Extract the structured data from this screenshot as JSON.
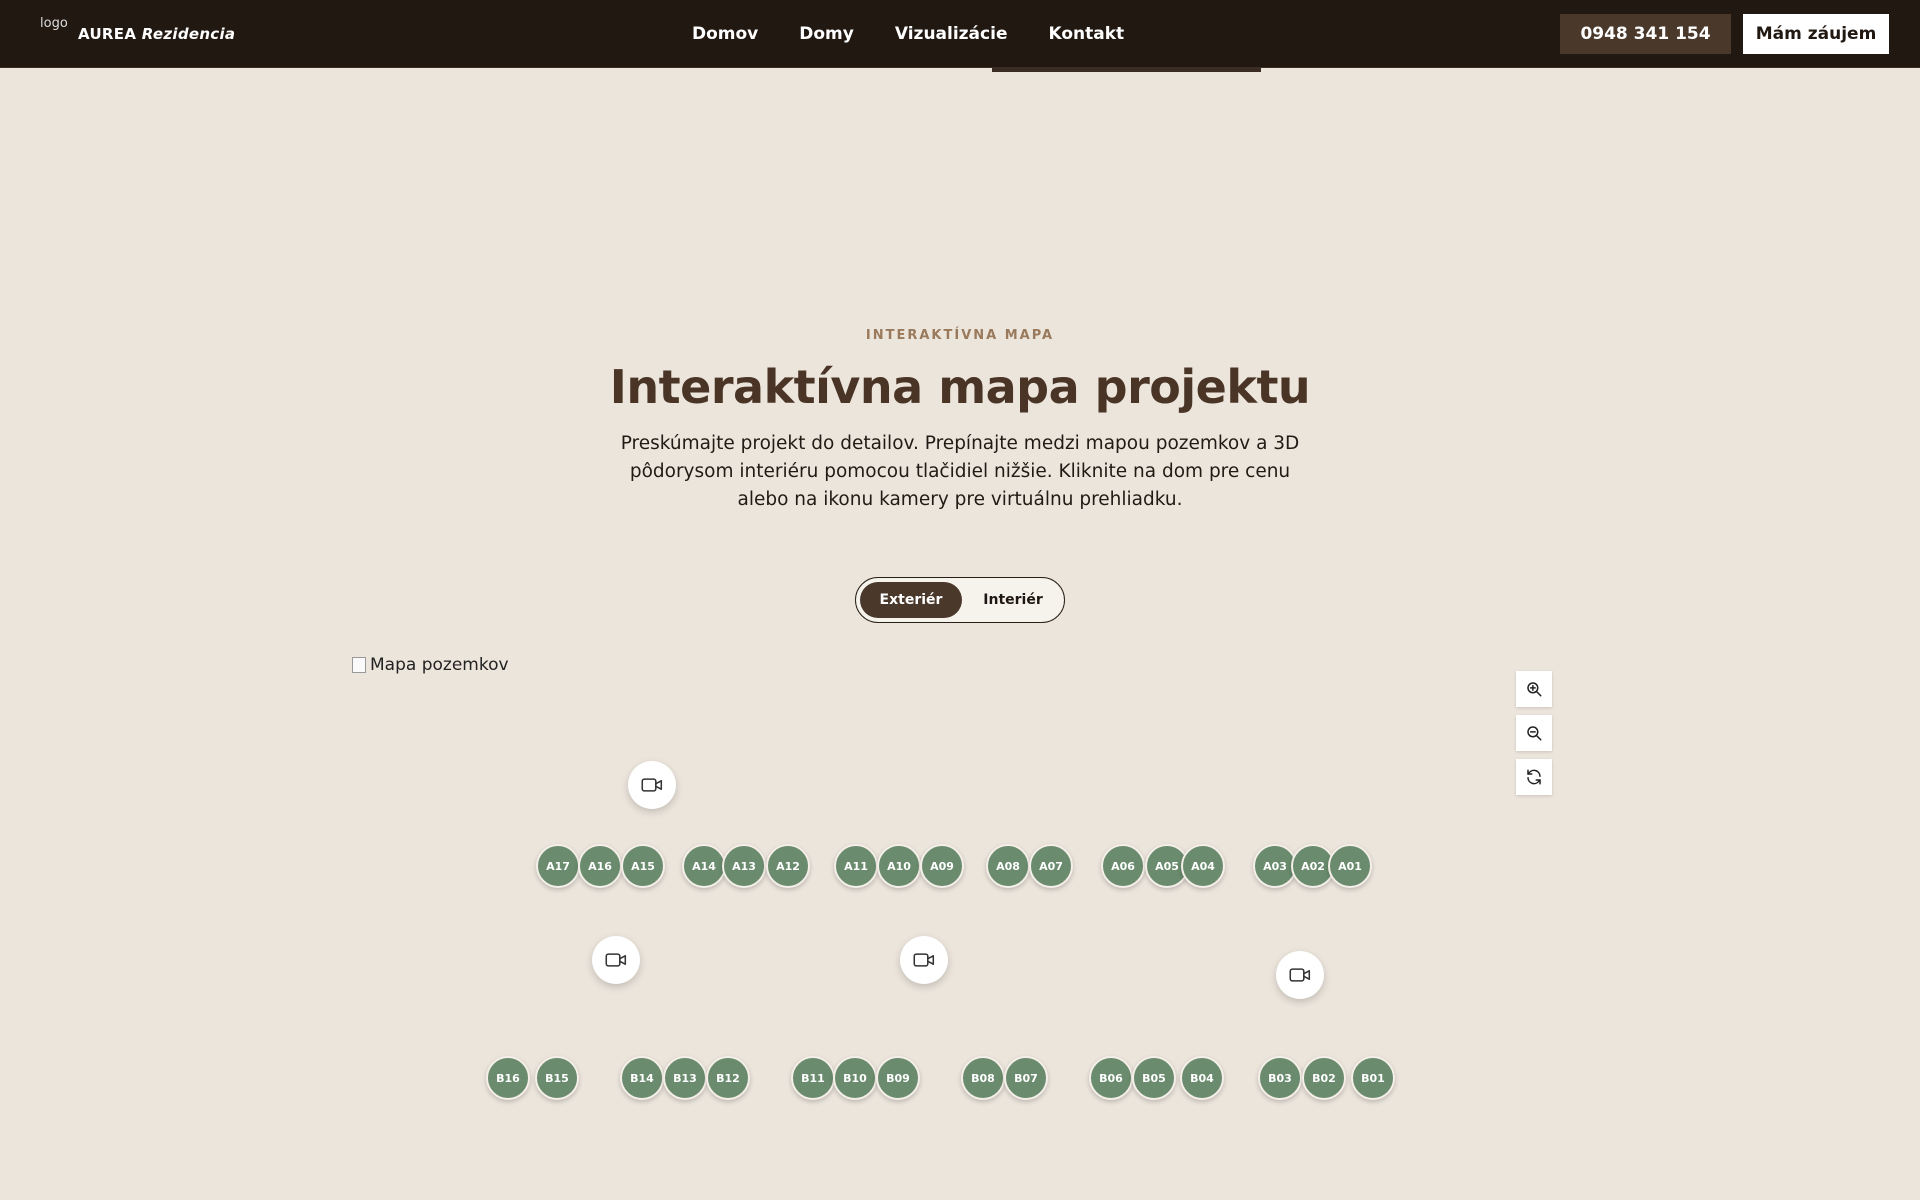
{
  "header": {
    "logo_alt": "logo",
    "brand_name": "AUREA",
    "brand_tagline": "Rezidencia",
    "nav": [
      "Domov",
      "Domy",
      "Vizualizácie",
      "Kontakt"
    ],
    "phone": "0948 341 154",
    "cta": "Mám záujem"
  },
  "hero": {
    "eyebrow": "INTERAKTÍVNA MAPA",
    "title": "Interaktívna mapa projektu",
    "lead": "Preskúmajte projekt do detailov. Prepínajte medzi mapou pozemkov a 3D pôdorysom interiéru pomocou tlačidiel nižšie. Kliknite na dom pre cenu alebo na ikonu kamery pre virtuálnu prehliadku."
  },
  "toggle": {
    "exterior": "Exteriér",
    "interior": "Interiér",
    "active": "Exteriér"
  },
  "map": {
    "image_alt": "Mapa pozemkov",
    "controls": [
      "zoom-in-icon",
      "zoom-out-icon",
      "reset-icon"
    ],
    "houses_row_a": [
      "A17",
      "A16",
      "A15",
      "A14",
      "A13",
      "A12",
      "A11",
      "A10",
      "A09",
      "A08",
      "A07",
      "A06",
      "A05",
      "A04",
      "A03",
      "A02",
      "A01"
    ],
    "houses_row_b": [
      "B16",
      "B15",
      "B14",
      "B13",
      "B12",
      "B11",
      "B10",
      "B09",
      "B08",
      "B07",
      "B06",
      "B05",
      "B04",
      "B03",
      "B02",
      "B01"
    ]
  },
  "colors": {
    "header_bg": "#211812",
    "page_bg": "#ece5dc",
    "accent_brown": "#4a382b",
    "house_green": "#6a8b6d",
    "eyebrow": "#9a7a5c",
    "title": "#4a3426"
  }
}
